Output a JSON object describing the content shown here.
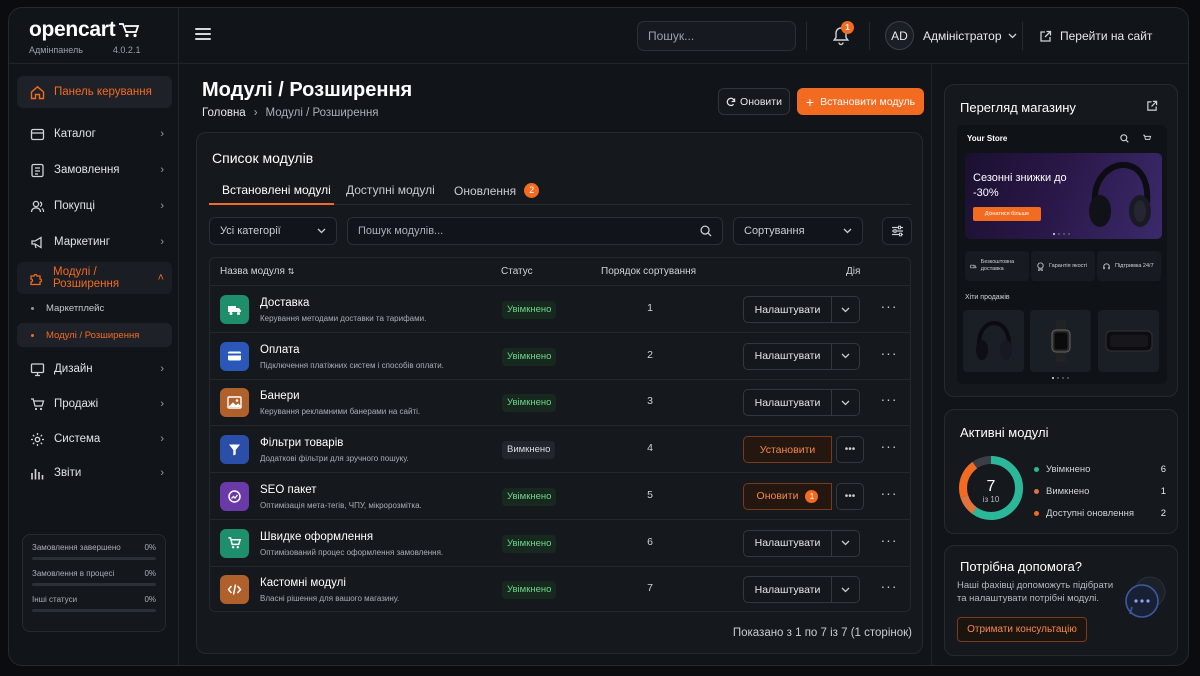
{
  "brand": {
    "name": "opencart",
    "subtitle": "Адмінпанель",
    "version": "4.0.2.1"
  },
  "header": {
    "search_placeholder": "Пошук...",
    "notifications_count": "1",
    "avatar_initials": "AD",
    "admin_label": "Адміністратор",
    "go_site_label": "Перейти на сайт"
  },
  "sidebar": {
    "items": [
      {
        "label": "Панель керування",
        "icon": "home-icon"
      },
      {
        "label": "Каталог",
        "icon": "tag-icon"
      },
      {
        "label": "Замовлення",
        "icon": "orders-icon"
      },
      {
        "label": "Покупці",
        "icon": "users-icon"
      },
      {
        "label": "Маркетинг",
        "icon": "megaphone-icon"
      },
      {
        "label": "Модулі / Розширення",
        "icon": "puzzle-icon"
      },
      {
        "label": "Дизайн",
        "icon": "monitor-icon"
      },
      {
        "label": "Продажі",
        "icon": "cart-icon"
      },
      {
        "label": "Система",
        "icon": "gear-icon"
      },
      {
        "label": "Звіти",
        "icon": "chart-icon"
      }
    ],
    "subitems": [
      {
        "label": "Маркетплейс"
      },
      {
        "label": "Модулі / Розширення"
      }
    ],
    "stats": [
      {
        "label": "Замовлення завершено",
        "value": "0%"
      },
      {
        "label": "Замовлення в процесі",
        "value": "0%"
      },
      {
        "label": "Інші статуси",
        "value": "0%"
      }
    ]
  },
  "main": {
    "title": "Модулі / Розширення",
    "breadcrumb": {
      "home": "Головна",
      "sep": "›",
      "current": "Модулі / Розширення"
    },
    "refresh_label": "Оновити",
    "install_label": "Встановити модуль",
    "panel_title": "Список модулів",
    "tabs": [
      {
        "label": "Встановлені модулі"
      },
      {
        "label": "Доступні модулі"
      },
      {
        "label": "Оновлення",
        "badge": "2"
      }
    ],
    "filters": {
      "category": "Усі категорії",
      "search_placeholder": "Пошук модулів...",
      "sort": "Сортування"
    },
    "columns": {
      "name": "Назва модуля",
      "status": "Статус",
      "order": "Порядок сортування",
      "action": "Дія"
    },
    "rows": [
      {
        "name": "Доставка",
        "desc": "Керування методами доставки та тарифами.",
        "status": "Увімкнено",
        "order": "1",
        "action": "Налаштувати",
        "color": "#1f8f6b",
        "icon": "truck-icon"
      },
      {
        "name": "Оплата",
        "desc": "Підключення платіжних систем і способів оплати.",
        "status": "Увімкнено",
        "order": "2",
        "action": "Налаштувати",
        "color": "#2b57b8",
        "icon": "card-icon"
      },
      {
        "name": "Банери",
        "desc": "Керування рекламними банерами на сайті.",
        "status": "Увімкнено",
        "order": "3",
        "action": "Налаштувати",
        "color": "#b0602a",
        "icon": "image-icon"
      },
      {
        "name": "Фільтри товарів",
        "desc": "Додаткові фільтри для зручного пошуку.",
        "status": "Вимкнено",
        "order": "4",
        "action": "Установити",
        "color": "#2b4fa8",
        "icon": "filter-icon"
      },
      {
        "name": "SEO пакет",
        "desc": "Оптимізація мета-тегів, ЧПУ, мікророзмітка.",
        "status": "Увімкнено",
        "order": "5",
        "action": "Оновити",
        "action_badge": "1",
        "color": "#6a3aa8",
        "icon": "seo-icon"
      },
      {
        "name": "Швидке оформлення",
        "desc": "Оптимізований процес оформлення замовлення.",
        "status": "Увімкнено",
        "order": "6",
        "action": "Налаштувати",
        "color": "#1f8f6b",
        "icon": "cart-icon"
      },
      {
        "name": "Кастомні модулі",
        "desc": "Власні рішення для вашого магазину.",
        "status": "Увімкнено",
        "order": "7",
        "action": "Налаштувати",
        "color": "#b0602a",
        "icon": "code-icon"
      }
    ],
    "pagination": "Показано з 1 по 7 із 7 (1 сторінок)"
  },
  "right": {
    "preview": {
      "title": "Перегляд магазину",
      "store_name": "Your Store",
      "hero_title": "Сезонні знижки до -30%",
      "hero_button": "Дізнатися більше",
      "features": [
        {
          "label": "Безкоштовна доставка"
        },
        {
          "label": "Гарантія якості"
        },
        {
          "label": "Підтримка 24/7"
        }
      ],
      "bestsellers": "Хіти продажів"
    },
    "active": {
      "title": "Активні модулі",
      "total": "7",
      "total_sub": "із 10",
      "enabled_fraction": 0.6,
      "disabled_fraction": 0.1,
      "updates_fraction": 0.2,
      "legend": [
        {
          "label": "Увімкнено",
          "value": "6",
          "color": "#2bb89a"
        },
        {
          "label": "Вимкнено",
          "value": "1",
          "color": "#e0743c"
        },
        {
          "label": "Доступні оновлення",
          "value": "2",
          "color": "#f26b21"
        }
      ]
    },
    "help": {
      "title": "Потрібна допомога?",
      "text": "Наші фахівці допоможуть підібрати та налаштувати потрібні модулі.",
      "button": "Отримати консультацію"
    }
  }
}
